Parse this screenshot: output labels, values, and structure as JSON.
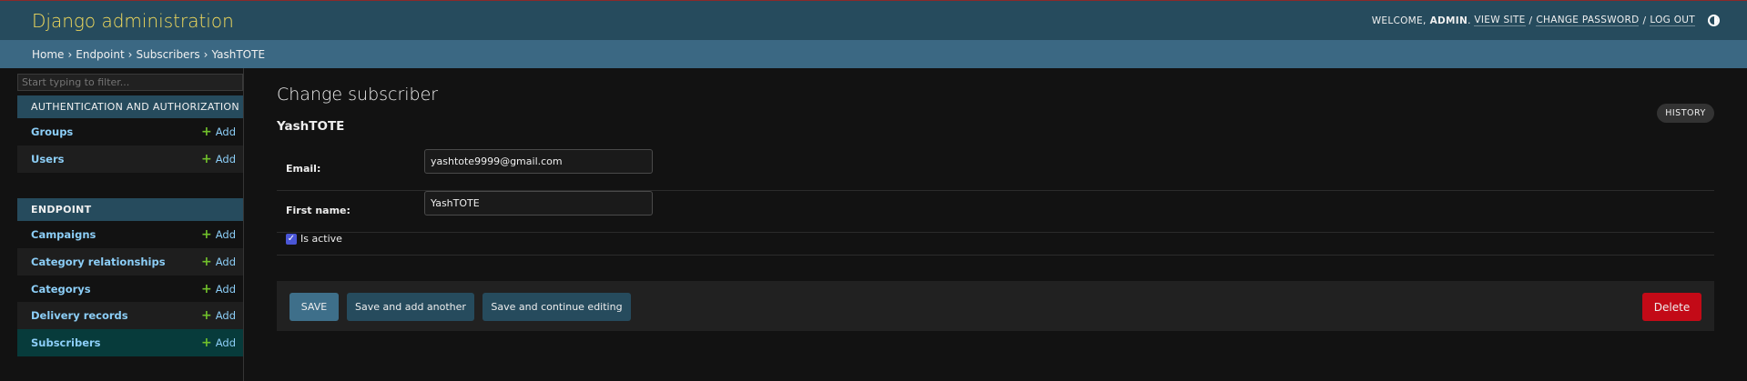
{
  "header": {
    "brand": "Django administration",
    "welcome": "Welcome,",
    "username": "admin",
    "view_site": "View site",
    "change_password": "Change password",
    "log_out": "Log out",
    "sep": "/",
    "icon": "theme-toggle-icon"
  },
  "breadcrumbs": {
    "home": "Home",
    "app": "Endpoint",
    "model": "Subscribers",
    "current": "YashTOTE",
    "arrow": "›"
  },
  "sidebar": {
    "filter_placeholder": "Start typing to filter...",
    "modules": [
      {
        "caption": "Authentication and Authorization",
        "items": [
          {
            "name": "Groups",
            "add": "Add"
          },
          {
            "name": "Users",
            "add": "Add"
          }
        ]
      },
      {
        "caption": "Endpoint",
        "items": [
          {
            "name": "Campaigns",
            "add": "Add"
          },
          {
            "name": "Category relationships",
            "add": "Add"
          },
          {
            "name": "Categorys",
            "add": "Add"
          },
          {
            "name": "Delivery records",
            "add": "Add"
          },
          {
            "name": "Subscribers",
            "add": "Add"
          }
        ]
      }
    ],
    "plus": "+"
  },
  "main": {
    "title": "Change subscriber",
    "history": "History",
    "object_name": "YashTOTE",
    "fields": {
      "email_label": "Email:",
      "email_value": "yashtote9999@gmail.com",
      "first_name_label": "First name:",
      "first_name_value": "YashTOTE",
      "is_active_label": "Is active",
      "is_active_checked": true
    },
    "buttons": {
      "save": "Save",
      "save_add_another": "Save and add another",
      "save_continue": "Save and continue editing",
      "delete": "Delete"
    }
  },
  "colors": {
    "header_bg": "#264b5d",
    "brand": "#f5dd5d",
    "link": "#8ccef7",
    "delete": "#c30a17",
    "add_plus": "#70bf2b"
  }
}
